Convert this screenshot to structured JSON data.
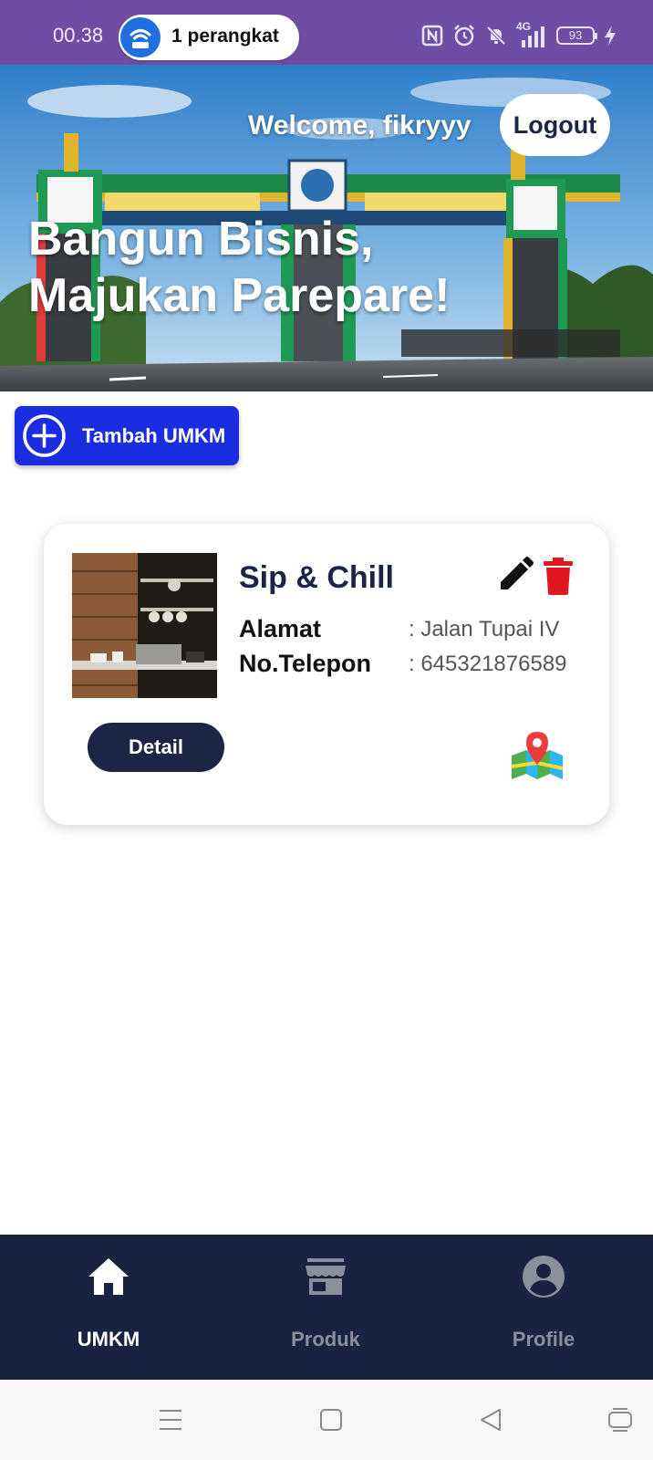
{
  "status_bar": {
    "time": "00.38",
    "hotspot_text": "1 perangkat",
    "network_label": "4G",
    "battery_level": "93",
    "icons": [
      "hotspot-icon",
      "nfc-icon",
      "alarm-icon",
      "mute-icon",
      "signal-icon",
      "battery-icon",
      "charging-icon"
    ]
  },
  "header": {
    "welcome": "Welcome, fikryyy",
    "logout_label": "Logout",
    "hero_title_line1": "Bangun Bisnis,",
    "hero_title_line2": "Majukan Parepare!"
  },
  "actions": {
    "add_label": "Tambah UMKM",
    "add_icon": "plus-circle-icon"
  },
  "umkm_list": [
    {
      "name": "Sip & Chill",
      "address_label": "Alamat",
      "address_value": ": Jalan Tupai IV",
      "phone_label": "No.Telepon",
      "phone_value": ": 645321876589",
      "detail_label": "Detail",
      "icons": [
        "edit-icon",
        "delete-icon",
        "map-icon"
      ]
    }
  ],
  "bottom_nav": {
    "items": [
      {
        "label": "UMKM",
        "icon": "home-icon",
        "active": true
      },
      {
        "label": "Produk",
        "icon": "store-icon",
        "active": false
      },
      {
        "label": "Profile",
        "icon": "profile-icon",
        "active": false
      }
    ],
    "active_color": "#ffffff",
    "inactive_color": "#8a8f9c"
  },
  "colors": {
    "status_bar": "#6f4da4",
    "accent_blue": "#1a2de0",
    "navy": "#1b2545",
    "delete_red": "#e0171e"
  }
}
